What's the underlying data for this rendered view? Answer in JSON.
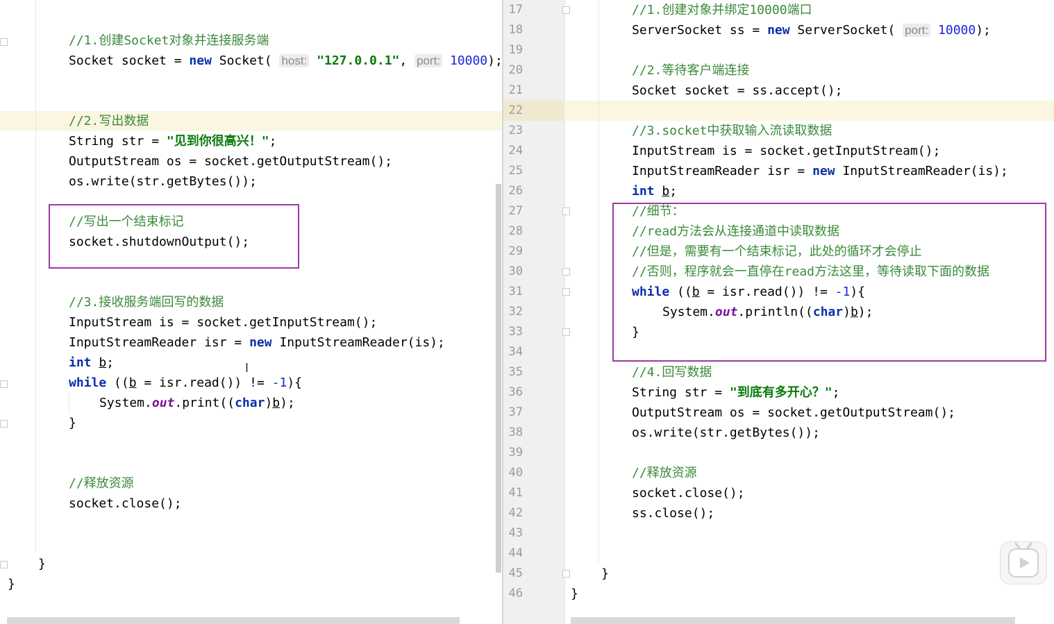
{
  "left": {
    "c1": "//1.创建Socket对象并连接服务端",
    "l1a": "Socket socket = ",
    "l1kw": "new",
    "l1b": " Socket( ",
    "host_hint": "host:",
    "host_val": "\"127.0.0.1\"",
    "comma": ", ",
    "port_hint": "port:",
    "port_val": "10000",
    "l1end": ");",
    "c2": "//2.写出数据",
    "l2a": "String str = ",
    "l2str": "\"见到你很高兴！\"",
    "semi": ";",
    "l3": "OutputStream os = socket.getOutputStream();",
    "l4": "os.write(str.getBytes());",
    "c3": "//写出一个结束标记",
    "l5": "socket.shutdownOutput();",
    "c4": "//3.接收服务端回写的数据",
    "l6": "InputStream is = socket.getInputStream();",
    "l7a": "InputStreamReader isr = ",
    "l7kw": "new",
    "l7b": " InputStreamReader(is);",
    "int_kw": "int",
    "b_var": "b",
    "while_kw": "while",
    "w_open": " ((",
    "w_mid": " = isr.read()) != ",
    "w_num": "-1",
    "w_end": "){",
    "p_a": "System.",
    "p_out": "out",
    "p_b": ".print((",
    "char_kw": "char",
    "p_c": ")",
    "p_end": ");",
    "brace": "}",
    "c5": "//释放资源",
    "l_close": "socket.close();",
    "end1": "}",
    "end2": "}"
  },
  "right": {
    "line_numbers": [
      "17",
      "18",
      "19",
      "20",
      "21",
      "22",
      "23",
      "24",
      "25",
      "26",
      "27",
      "28",
      "29",
      "30",
      "31",
      "32",
      "33",
      "34",
      "35",
      "36",
      "37",
      "38",
      "39",
      "40",
      "41",
      "42",
      "43",
      "44",
      "45",
      "46"
    ],
    "c1": "//1.创建对象并绑定10000端口",
    "r18a": "ServerSocket ss = ",
    "r18kw": "new",
    "r18b": " ServerSocket( ",
    "port_hint": "port:",
    "port_val": "10000",
    "r18end": ");",
    "c2": "//2.等待客户端连接",
    "r21": "Socket socket = ss.accept();",
    "c3": "//3.socket中获取输入流读取数据",
    "r24": "InputStream is = socket.getInputStream();",
    "r25a": "InputStreamReader isr = ",
    "r25kw": "new",
    "r25b": " InputStreamReader(is);",
    "int_kw": "int",
    "b_var": "b",
    "semi": ";",
    "c4": "//细节：",
    "c5": "//read方法会从连接通道中读取数据",
    "c6": "//但是，需要有一个结束标记，此处的循环才会停止",
    "c7": "//否则，程序就会一直停在read方法这里，等待读取下面的数据",
    "while_kw": "while",
    "w_open": " ((",
    "w_mid": " = isr.read()) != ",
    "w_num": "-1",
    "w_end": "){",
    "p_a": "System.",
    "p_out": "out",
    "p_b": ".println((",
    "char_kw": "char",
    "p_c": ")",
    "p_end": ");",
    "brace": "}",
    "c8": "//4.回写数据",
    "r36a": "String str = ",
    "r36str": "\"到底有多开心？\"",
    "r37": "OutputStream os = socket.getOutputStream();",
    "r38": "os.write(str.getBytes());",
    "c9": "//释放资源",
    "r41": "socket.close();",
    "r42": "ss.close();",
    "end1": "}",
    "end2": "}"
  },
  "icons": {
    "cursor": "text-cursor-icon",
    "video": "video-play-icon"
  },
  "colors": {
    "keyword": "#0b2fa8",
    "comment": "#3a8a3a",
    "string": "#0a7a0a",
    "number": "#1a25d8",
    "box": "#9b3aa3",
    "highlight": "#fbf6e1"
  }
}
